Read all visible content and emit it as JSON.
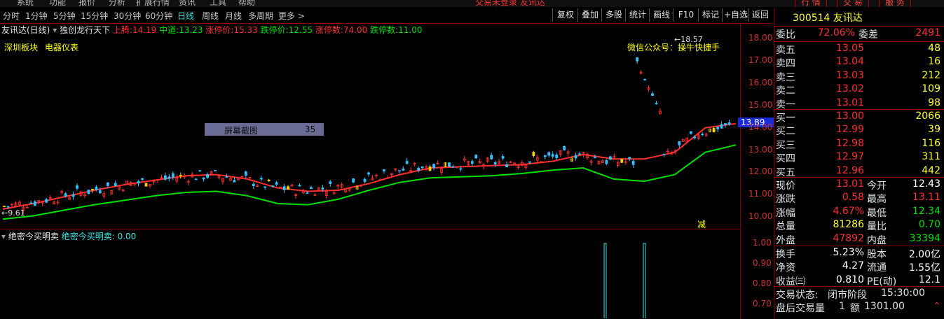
{
  "menubar": {
    "items": [
      "系统",
      "功能",
      "报价",
      "分析",
      "扩展行情",
      "资讯",
      "工具",
      "帮助"
    ],
    "warning": "交易未登录 友讯达",
    "buttons": [
      "行 情",
      "交 易",
      "服 务"
    ]
  },
  "toolbar": {
    "periods": [
      "分时",
      "1分钟",
      "5分钟",
      "15分钟",
      "30分钟",
      "60分钟",
      "日线",
      "周线",
      "月线",
      "多周期",
      "更多 >"
    ],
    "active": "日线",
    "right": [
      "复权",
      "叠加",
      "多股",
      "统计",
      "画线",
      "F10",
      "标记",
      "+自选",
      "返回"
    ]
  },
  "header": {
    "name": "友讯达(日线)",
    "indicator": "独创龙行天下",
    "items": [
      {
        "label": "上腾:",
        "value": "14.19",
        "color": "#ff3030"
      },
      {
        "label": "中道:",
        "value": "13.23",
        "color": "#00e000"
      },
      {
        "label": "涨停价:",
        "value": "15.33",
        "color": "#ff3030"
      },
      {
        "label": "跌停价:",
        "value": "12.55",
        "color": "#00e000"
      },
      {
        "label": "涨停数:",
        "value": "74.00",
        "color": "#ff3030"
      },
      {
        "label": "跌停数:",
        "value": "11.00",
        "color": "#00e000"
      }
    ]
  },
  "sectors": [
    "深圳板块",
    "电器仪表"
  ],
  "wechat": "微信公众号：操牛快捷手",
  "popup": {
    "label": "屏幕截图",
    "count": "35"
  },
  "price_tag": "13.89",
  "high_mark": "18.57",
  "low_mark": "9.61",
  "jian_mark": "减",
  "yaxis": [
    "18.00",
    "17.00",
    "16.00",
    "15.00",
    "14.00",
    "13.00",
    "12.00",
    "11.00",
    "10.00"
  ],
  "sub": {
    "title": "绝密今买明卖",
    "label": "绝密今买明卖:",
    "value": "0.00",
    "yaxis": [
      "1.00",
      "0.90",
      "0.80",
      "0.70"
    ]
  },
  "quote": {
    "code": "300514",
    "name": "友讯达",
    "weibi": {
      "label": "委比",
      "value": "72.06%"
    },
    "weicha": {
      "label": "委差",
      "value": "2491"
    },
    "sell": [
      {
        "l": "卖五",
        "p": "13.05",
        "v": "48"
      },
      {
        "l": "卖四",
        "p": "13.04",
        "v": "16"
      },
      {
        "l": "卖三",
        "p": "13.03",
        "v": "212"
      },
      {
        "l": "卖二",
        "p": "13.02",
        "v": "109"
      },
      {
        "l": "卖一",
        "p": "13.01",
        "v": "98"
      }
    ],
    "buy": [
      {
        "l": "买一",
        "p": "13.00",
        "v": "2066"
      },
      {
        "l": "买二",
        "p": "12.99",
        "v": "39"
      },
      {
        "l": "买三",
        "p": "12.98",
        "v": "116"
      },
      {
        "l": "买四",
        "p": "12.97",
        "v": "311"
      },
      {
        "l": "买五",
        "p": "12.96",
        "v": "442"
      }
    ],
    "stats": [
      {
        "l1": "现价",
        "v1": "13.01",
        "c1": "#ff3030",
        "l2": "今开",
        "v2": "12.43",
        "c2": "#ffffff"
      },
      {
        "l1": "涨跌",
        "v1": "0.58",
        "c1": "#ff3030",
        "l2": "最高",
        "v2": "13.11",
        "c2": "#ff3030"
      },
      {
        "l1": "涨幅",
        "v1": "4.67%",
        "c1": "#ff3030",
        "l2": "最低",
        "v2": "12.34",
        "c2": "#00e000"
      },
      {
        "l1": "总量",
        "v1": "81286",
        "c1": "#ffff30",
        "l2": "量比",
        "v2": "0.70",
        "c2": "#00e000"
      },
      {
        "l1": "外盘",
        "v1": "47892",
        "c1": "#ff3030",
        "l2": "内盘",
        "v2": "33394",
        "c2": "#00e000"
      }
    ],
    "stats2": [
      {
        "l1": "换手",
        "v1": "5.23%",
        "l2": "股本",
        "v2": "2.00亿"
      },
      {
        "l1": "净资",
        "v1": "4.27",
        "l2": "流通",
        "v2": "1.55亿"
      },
      {
        "l1": "收益㈢",
        "v1": "0.810",
        "l2": "PE(动)",
        "v2": "12.1"
      }
    ],
    "status": {
      "label": "交易状态:",
      "value": "闭市阶段",
      "time": "15:30:00"
    },
    "after": {
      "label": "盘后交易量",
      "v1": "1",
      "label2": "额",
      "v2": "1301.00"
    }
  },
  "chart_data": {
    "type": "candlestick",
    "ylim": [
      9.5,
      18.7
    ],
    "series": [
      {
        "name": "上腾",
        "color": "#ff3030",
        "values": [
          10.35,
          10.6,
          10.9,
          11.2,
          11.45,
          11.65,
          11.85,
          11.9,
          11.7,
          11.3,
          11.15,
          11.2,
          11.5,
          11.9,
          12.2,
          12.25,
          12.3,
          12.35,
          12.5,
          12.8,
          12.6,
          12.6,
          12.9,
          14.0,
          14.19
        ]
      },
      {
        "name": "中道",
        "color": "#00e000",
        "values": [
          9.9,
          10.05,
          10.3,
          10.55,
          10.75,
          10.95,
          11.1,
          11.15,
          10.95,
          10.6,
          10.55,
          10.8,
          11.2,
          11.55,
          11.75,
          11.8,
          11.85,
          11.95,
          12.1,
          12.2,
          11.7,
          11.6,
          11.9,
          12.9,
          13.23
        ]
      }
    ],
    "sub_series": {
      "name": "绝密今买明卖",
      "spikes": [
        1.0,
        1.0
      ]
    }
  }
}
